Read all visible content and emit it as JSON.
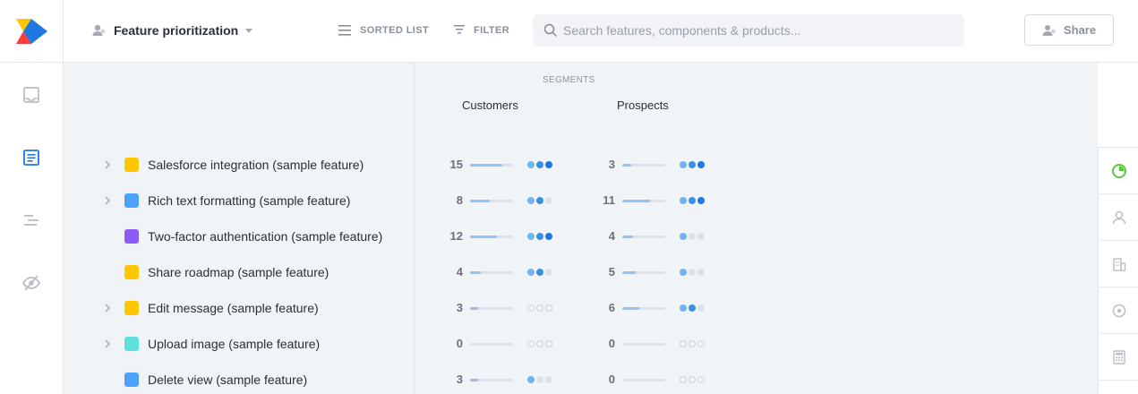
{
  "header": {
    "view_name": "Feature prioritization",
    "sorted_list_label": "SORTED LIST",
    "filter_label": "FILTER",
    "search_placeholder": "Search features, components & products...",
    "share_label": "Share"
  },
  "segments": {
    "title": "SEGMENTS",
    "columns": [
      "Customers",
      "Prospects"
    ]
  },
  "features": [
    {
      "name": "Salesforce integration (sample feature)",
      "color": "#ffc700",
      "expandable": true,
      "customers": {
        "count": "15",
        "fill": 0.75,
        "dots": [
          1,
          2,
          3
        ]
      },
      "prospects": {
        "count": "3",
        "fill": 0.2,
        "dots": [
          1,
          2,
          3
        ]
      }
    },
    {
      "name": "Rich text formatting (sample feature)",
      "color": "#4da3fb",
      "expandable": true,
      "customers": {
        "count": "8",
        "fill": 0.45,
        "dots": [
          1,
          2,
          -1
        ]
      },
      "prospects": {
        "count": "11",
        "fill": 0.65,
        "dots": [
          1,
          2,
          3
        ]
      }
    },
    {
      "name": "Two-factor authentication (sample feature)",
      "color": "#8b5cf6",
      "expandable": false,
      "customers": {
        "count": "12",
        "fill": 0.62,
        "dots": [
          1,
          2,
          3
        ]
      },
      "prospects": {
        "count": "4",
        "fill": 0.25,
        "dots": [
          1,
          -1,
          -1
        ]
      }
    },
    {
      "name": "Share roadmap (sample feature)",
      "color": "#ffc700",
      "expandable": false,
      "customers": {
        "count": "4",
        "fill": 0.25,
        "dots": [
          1,
          2,
          -1
        ]
      },
      "prospects": {
        "count": "5",
        "fill": 0.32,
        "dots": [
          1,
          -1,
          -1
        ]
      }
    },
    {
      "name": "Edit message (sample feature)",
      "color": "#ffc700",
      "expandable": true,
      "customers": {
        "count": "3",
        "fill": 0.18,
        "dots": [
          0,
          0,
          0
        ]
      },
      "prospects": {
        "count": "6",
        "fill": 0.4,
        "dots": [
          1,
          2,
          -1
        ]
      }
    },
    {
      "name": "Upload image (sample feature)",
      "color": "#5ee0e0",
      "expandable": true,
      "customers": {
        "count": "0",
        "fill": 0,
        "dots": [
          0,
          0,
          0
        ]
      },
      "prospects": {
        "count": "0",
        "fill": 0,
        "dots": [
          0,
          0,
          0
        ]
      }
    },
    {
      "name": "Delete view (sample feature)",
      "color": "#4da3fb",
      "expandable": false,
      "customers": {
        "count": "3",
        "fill": 0.18,
        "dots": [
          1,
          -1,
          -1
        ]
      },
      "prospects": {
        "count": "0",
        "fill": 0,
        "dots": [
          0,
          0,
          0
        ]
      }
    }
  ],
  "icons": {
    "logo": "productboard-logo",
    "left_nav": [
      "inbox-icon",
      "notes-icon",
      "roadmap-icon",
      "insights-icon"
    ],
    "right_rail": [
      "prioritization-icon",
      "user-icon",
      "company-icon",
      "target-icon",
      "calculator-icon"
    ]
  },
  "colors": {
    "accent": "#1f77df",
    "active_green": "#5cc63b",
    "panel_bg": "#f1f4f7"
  }
}
